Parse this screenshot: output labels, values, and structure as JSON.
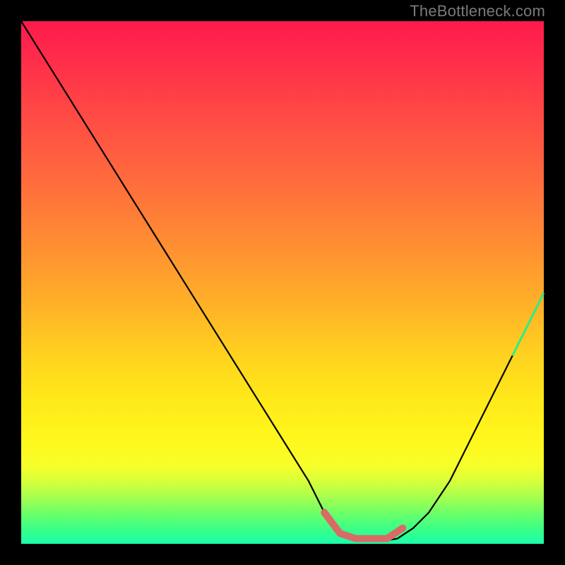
{
  "watermark": "TheBottleneck.com",
  "chart_data": {
    "type": "line",
    "title": "",
    "xlabel": "",
    "ylabel": "",
    "xlim": [
      0,
      100
    ],
    "ylim": [
      0,
      100
    ],
    "grid": false,
    "legend": false,
    "series": [
      {
        "name": "bottleneck-curve",
        "x": [
          0,
          5,
          10,
          15,
          20,
          25,
          30,
          35,
          40,
          45,
          50,
          55,
          58,
          60,
          63,
          66,
          69,
          72,
          75,
          78,
          82,
          86,
          90,
          94,
          97,
          100
        ],
        "values": [
          100,
          92,
          84,
          76,
          68,
          60,
          52,
          44,
          36,
          28,
          20,
          12,
          6,
          3,
          1,
          0.5,
          0.5,
          1,
          3,
          6,
          12,
          20,
          28,
          36,
          42,
          48
        ]
      }
    ],
    "annotations": [
      {
        "name": "optimal-region",
        "type": "line",
        "x": [
          58,
          61,
          64,
          67,
          70,
          73
        ],
        "values": [
          6,
          2,
          1,
          1,
          1,
          3
        ]
      }
    ]
  }
}
